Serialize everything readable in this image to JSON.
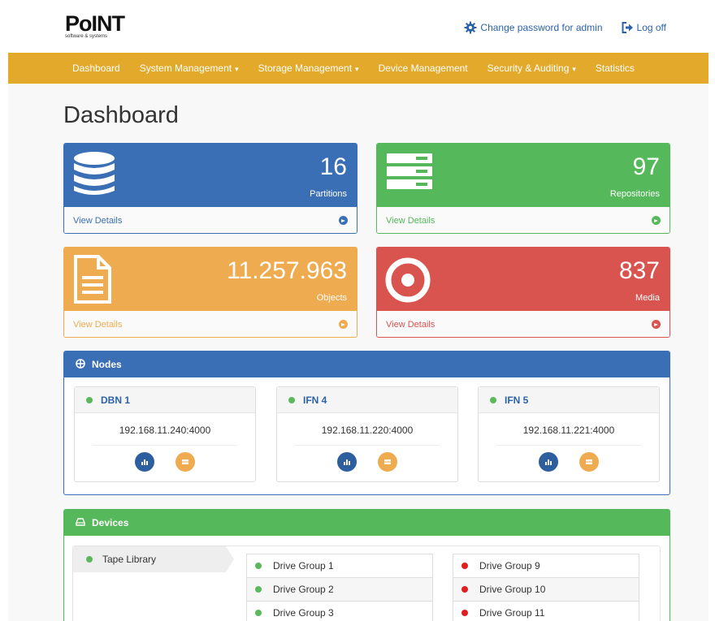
{
  "brand": {
    "logo_text": "PoINT",
    "logo_sub": "software & systems"
  },
  "top_links": [
    {
      "label": "Change password for admin",
      "icon": "gear-icon"
    },
    {
      "label": "Log off",
      "icon": "logout-icon"
    }
  ],
  "nav": [
    {
      "label": "Dashboard",
      "dropdown": false
    },
    {
      "label": "System Management",
      "dropdown": true
    },
    {
      "label": "Storage Management",
      "dropdown": true
    },
    {
      "label": "Device Management",
      "dropdown": false
    },
    {
      "label": "Security & Auditing",
      "dropdown": true
    },
    {
      "label": "Statistics",
      "dropdown": false
    }
  ],
  "page_title": "Dashboard",
  "cards": [
    {
      "value": "16",
      "label": "Partitions",
      "link": "View Details",
      "icon": "database-icon",
      "color": "#3a6fb5"
    },
    {
      "value": "97",
      "label": "Repositories",
      "link": "View Details",
      "icon": "server-icon",
      "color": "#55b85a"
    },
    {
      "value": "11.257.963",
      "label": "Objects",
      "link": "View Details",
      "icon": "document-icon",
      "color": "#efab4f"
    },
    {
      "value": "837",
      "label": "Media",
      "link": "View Details",
      "icon": "target-icon",
      "color": "#d9534f"
    }
  ],
  "nodes_panel": {
    "title": "Nodes",
    "color": "#3a6fb5",
    "nodes": [
      {
        "name": "DBN 1",
        "address": "192.168.11.240:4000",
        "status_color": "#5cb85c"
      },
      {
        "name": "IFN 4",
        "address": "192.168.11.220:4000",
        "status_color": "#5cb85c"
      },
      {
        "name": "IFN 5",
        "address": "192.168.11.221:4000",
        "status_color": "#5cb85c"
      }
    ]
  },
  "devices_panel": {
    "title": "Devices",
    "color": "#55b85a",
    "selected_device": "Tape Library",
    "selected_status_color": "#5cb85c",
    "drive_groups_left": [
      {
        "label": "Drive Group 1",
        "status_color": "#5cb85c"
      },
      {
        "label": "Drive Group 2",
        "status_color": "#5cb85c"
      },
      {
        "label": "Drive Group 3",
        "status_color": "#5cb85c"
      }
    ],
    "drive_groups_right": [
      {
        "label": "Drive Group 9",
        "status_color": "#e02020"
      },
      {
        "label": "Drive Group 10",
        "status_color": "#e02020"
      },
      {
        "label": "Drive Group 11",
        "status_color": "#e02020"
      }
    ]
  }
}
